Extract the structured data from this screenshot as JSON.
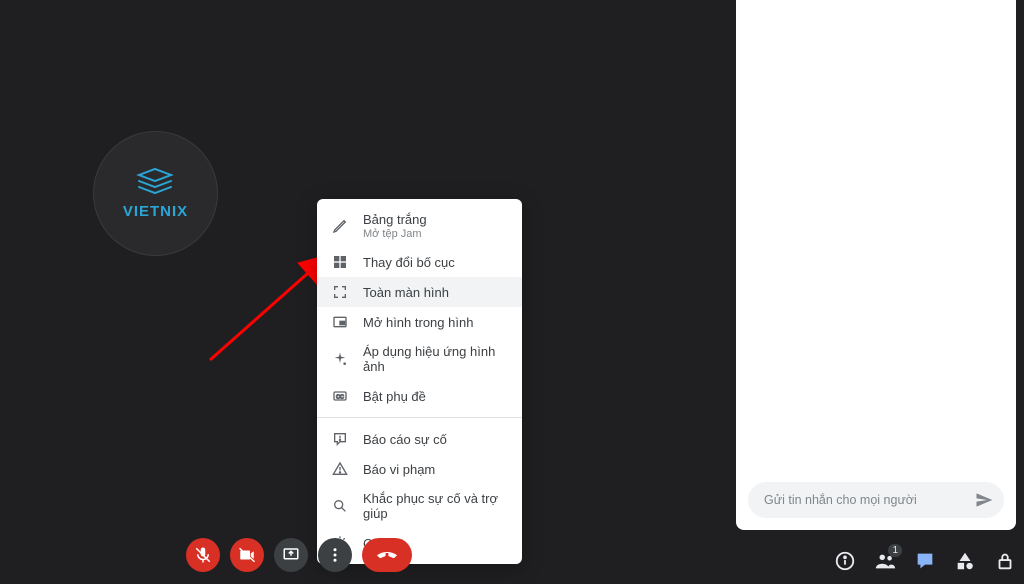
{
  "avatar": {
    "brand": "VIETNIX"
  },
  "menu": {
    "whiteboard": {
      "label": "Bảng trắng",
      "sub": "Mở tệp Jam"
    },
    "change_layout": "Thay đổi bố cục",
    "fullscreen": "Toàn màn hình",
    "pip": "Mở hình trong hình",
    "apply_effects": "Áp dụng hiệu ứng hình ảnh",
    "captions": "Bật phụ đề",
    "report_problem": "Báo cáo sự cố",
    "report_abuse": "Báo vi phạm",
    "troubleshoot": "Khắc phục sự cố và trợ giúp",
    "settings": "Cài đặt"
  },
  "chat": {
    "placeholder": "Gửi tin nhắn cho mọi người"
  },
  "toolbar": {
    "participant_count": "1"
  }
}
